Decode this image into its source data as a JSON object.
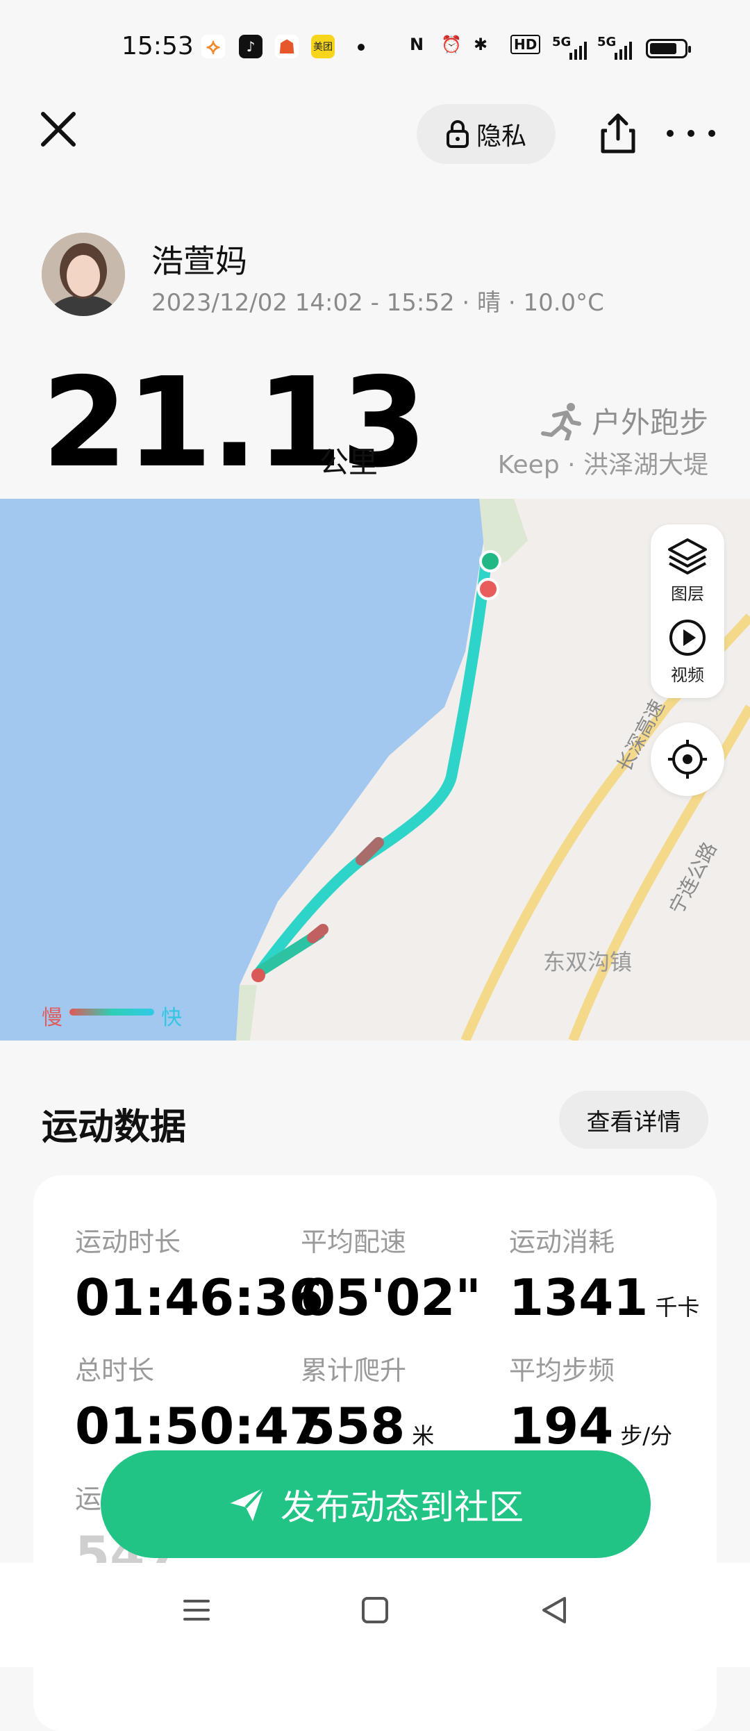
{
  "status_bar": {
    "time": "15:53",
    "app_icons": [
      "keep-icon",
      "tiktok-icon",
      "bot-icon",
      "meituan-icon"
    ],
    "meituan_label": "美团",
    "hd_label": "HD",
    "network_1": "5G",
    "network_2": "5G"
  },
  "header": {
    "privacy_label": "隐私"
  },
  "user": {
    "name": "浩萱妈",
    "meta": "2023/12/02 14:02 - 15:52 · 晴 · 10.0°C"
  },
  "summary": {
    "distance": "21.13",
    "distance_unit": "公里",
    "activity_type": "户外跑步",
    "source": "Keep · 洪泽湖大堤"
  },
  "map": {
    "layers_label": "图层",
    "video_label": "视频",
    "road_1": "长深高速",
    "road_2": "宁连公路",
    "town": "东双沟镇",
    "legend_slow": "慢",
    "legend_fast": "快",
    "colors": {
      "water": "#a2c8f0",
      "land": "#f1eeeb",
      "road": "#f4d98a",
      "route_fast": "#2fd4c8",
      "route_slow": "#e25757",
      "start": "#22b886"
    }
  },
  "stats": {
    "section_title": "运动数据",
    "detail_button": "查看详情",
    "items": [
      {
        "label": "运动时长",
        "value": "01:46:36",
        "unit": ""
      },
      {
        "label": "平均配速",
        "value": "05'02\"",
        "unit": ""
      },
      {
        "label": "运动消耗",
        "value": "1341",
        "unit": "千卡"
      },
      {
        "label": "总时长",
        "value": "01:50:47",
        "unit": ""
      },
      {
        "label": "累计爬升",
        "value": "558",
        "unit": "米"
      },
      {
        "label": "平均步频",
        "value": "194",
        "unit": "步/分"
      },
      {
        "label": "运",
        "value": "547",
        "unit": ""
      }
    ]
  },
  "publish_button": "发布动态到社区",
  "nav": [
    "menu-icon",
    "home-icon",
    "back-icon"
  ]
}
